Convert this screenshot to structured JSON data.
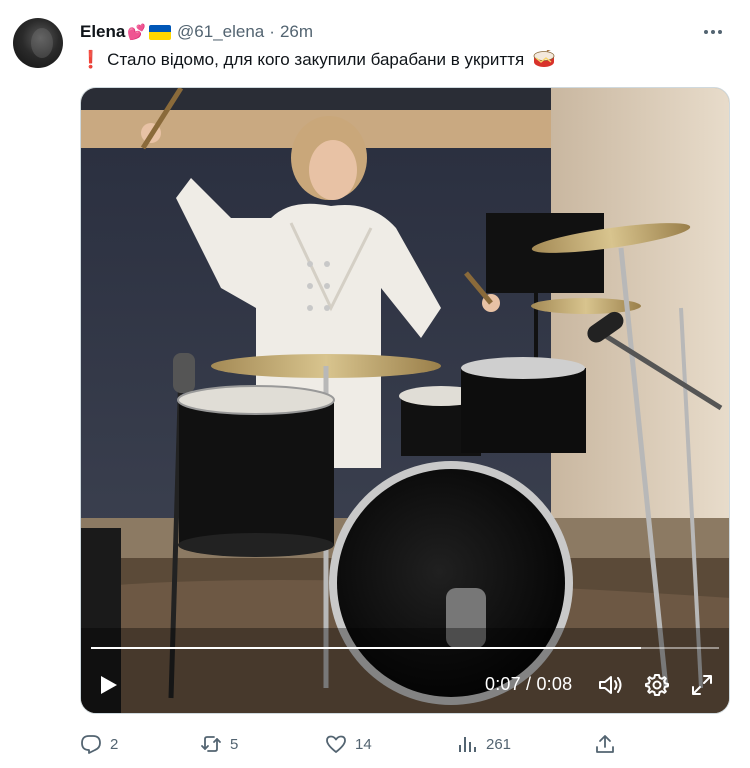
{
  "tweet": {
    "display_name": "Elena",
    "handle": "@61_elena",
    "separator": "·",
    "time": "26m",
    "text": "Стало відомо, для кого закупили барабани в укриття",
    "avatar_icon": "avatar-image",
    "name_emojis": [
      "two-hearts-icon",
      "ukraine-flag-icon"
    ],
    "text_prefix_icon": "exclamation-icon",
    "text_suffix_icon": "drum-icon"
  },
  "video": {
    "current_time": "0:07",
    "duration": "0:08",
    "time_separator": " / ",
    "progress": 0.875,
    "controls": [
      "play-icon",
      "volume-icon",
      "settings-icon",
      "fullscreen-icon"
    ]
  },
  "actions": {
    "replies": "2",
    "retweets": "5",
    "likes": "14",
    "views": "261"
  },
  "colors": {
    "text": "#0f1419",
    "secondary": "#536471",
    "heart": "#e0245e",
    "flag_blue": "#0057b7",
    "flag_yellow": "#ffd700"
  }
}
